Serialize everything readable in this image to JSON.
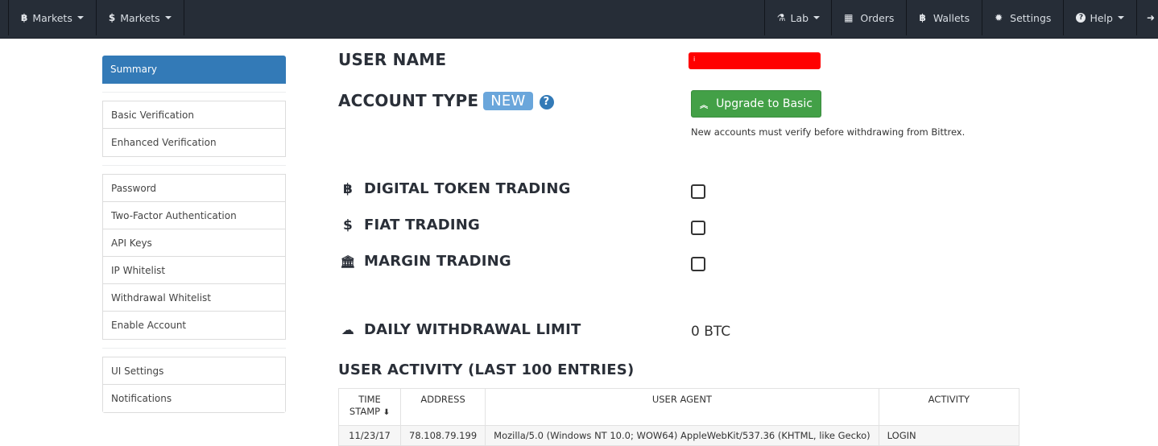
{
  "navbar": {
    "left": [
      {
        "icon": "bitcoin-icon",
        "glyph": "฿",
        "label": "Markets",
        "dropdown": true
      },
      {
        "icon": "dollar-icon",
        "glyph": "$",
        "label": "Markets",
        "dropdown": true
      }
    ],
    "right": [
      {
        "icon": "flask-icon",
        "glyph": "⚗",
        "label": "Lab",
        "dropdown": true
      },
      {
        "icon": "calendar-icon",
        "glyph": "▦",
        "label": "Orders",
        "dropdown": false
      },
      {
        "icon": "bitcoin-icon",
        "glyph": "฿",
        "label": "Wallets",
        "dropdown": false
      },
      {
        "icon": "gear-icon",
        "glyph": "✹",
        "label": "Settings",
        "dropdown": false
      },
      {
        "icon": "question-icon",
        "glyph": "?",
        "label": "Help",
        "dropdown": true
      },
      {
        "icon": "sign-out-icon",
        "glyph": "➜",
        "label": "",
        "dropdown": false
      }
    ]
  },
  "sidebar": {
    "active": "Summary",
    "groups": [
      [
        "Basic Verification",
        "Enhanced Verification"
      ],
      [
        "Password",
        "Two-Factor Authentication",
        "API Keys",
        "IP Whitelist",
        "Withdrawal Whitelist",
        "Enable Account"
      ],
      [
        "UI Settings",
        "Notifications"
      ]
    ]
  },
  "account": {
    "user_name_label": "USER NAME",
    "user_name_value": "i",
    "account_type_label": "ACCOUNT TYPE",
    "account_type_badge": "NEW",
    "help_glyph": "?",
    "upgrade_button": "Upgrade to Basic",
    "upgrade_note": "New accounts must verify before withdrawing from Bittrex."
  },
  "trading": [
    {
      "icon": "bitcoin-icon",
      "glyph": "฿",
      "label": "DIGITAL TOKEN TRADING",
      "checked": false
    },
    {
      "icon": "dollar-icon",
      "glyph": "$",
      "label": "FIAT TRADING",
      "checked": false
    },
    {
      "icon": "bank-icon",
      "glyph": "🏛",
      "label": "MARGIN TRADING",
      "checked": false
    }
  ],
  "withdrawal": {
    "label": "DAILY WITHDRAWAL LIMIT",
    "value": "0 BTC"
  },
  "activity": {
    "title": "USER ACTIVITY (LAST 100 ENTRIES)",
    "columns": [
      "TIME STAMP",
      "ADDRESS",
      "USER AGENT",
      "ACTIVITY"
    ],
    "sort_glyph": "🡻",
    "rows": [
      [
        "11/23/17",
        "78.108.79.199",
        "Mozilla/5.0 (Windows NT 10.0; WOW64) AppleWebKit/537.36 (KHTML, like Gecko)",
        "LOGIN"
      ]
    ]
  }
}
